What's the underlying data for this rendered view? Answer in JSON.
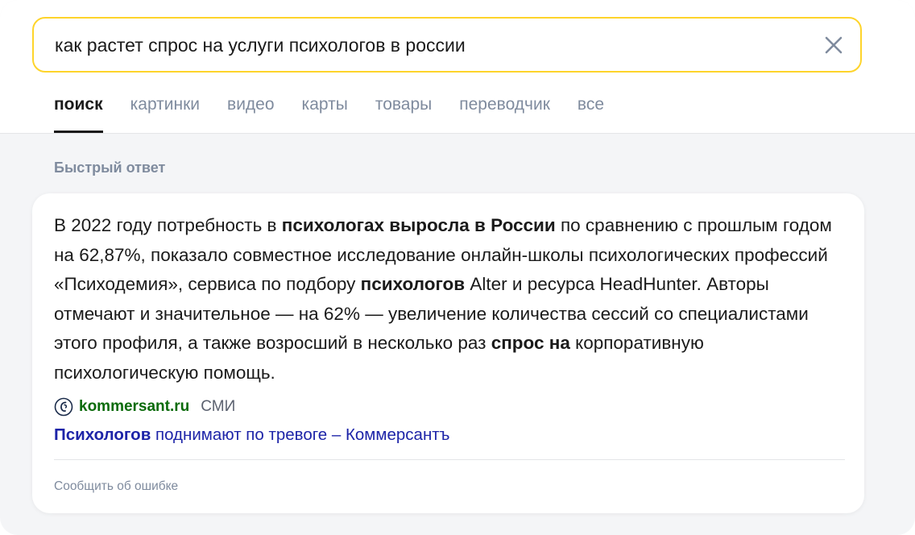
{
  "search": {
    "query": "как растет спрос на услуги психологов в россии"
  },
  "tabs": [
    {
      "label": "поиск",
      "active": true
    },
    {
      "label": "картинки",
      "active": false
    },
    {
      "label": "видео",
      "active": false
    },
    {
      "label": "карты",
      "active": false
    },
    {
      "label": "товары",
      "active": false
    },
    {
      "label": "переводчик",
      "active": false
    },
    {
      "label": "все",
      "active": false
    }
  ],
  "quick_answer": {
    "label": "Быстрый ответ",
    "text": {
      "p1": "В 2022 году потребность в ",
      "b1": "психологах выросла в России",
      "p2": " по сравнению с прошлым годом на 62,87%, показало совместное исследование онлайн-школы психологических профессий «Психодемия», сервиса по подбору ",
      "b2": "психологов",
      "p3": " Alter и ресурса HeadHunter. Авторы отмечают и значительное — на 62% — увеличение количества сессий со специалистами этого профиля, а также возросший в несколько раз ",
      "b3": "спрос на",
      "p4": " корпоративную психологическую помощь."
    },
    "source": {
      "icon": "kommersant-logo-icon",
      "domain": "kommersant.ru",
      "type": "СМИ",
      "link_bold": "Психологов",
      "link_rest": " поднимают по тревоге – Коммерсантъ"
    },
    "report_label": "Сообщить об ошибке"
  },
  "colors": {
    "search_border": "#fed42b",
    "muted": "#7f8b9e",
    "link": "#1d24a8",
    "domain": "#0b6b0b",
    "background": "#f4f5f7"
  }
}
